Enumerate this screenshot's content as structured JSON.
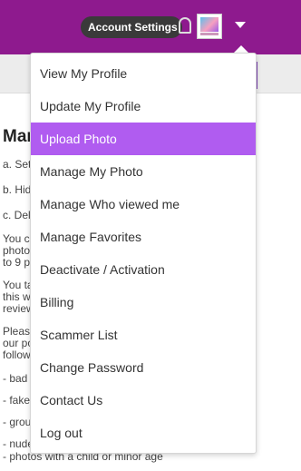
{
  "header": {
    "tooltip": "Account Settings",
    "brand_color": "#8e1a8e"
  },
  "menu": {
    "accent_color": "#b05cf0",
    "items": [
      {
        "label": "View My Profile"
      },
      {
        "label": "Update My Profile"
      },
      {
        "label": "Upload Photo",
        "active": true
      },
      {
        "label": "Manage My Photo"
      },
      {
        "label": "Manage Who viewed me"
      },
      {
        "label": "Manage Favorites"
      },
      {
        "label": "Deactivate / Activation"
      },
      {
        "label": "Billing"
      },
      {
        "label": "Scammer List"
      },
      {
        "label": "Change Password"
      },
      {
        "label": "Contact Us"
      },
      {
        "label": "Log out"
      }
    ]
  },
  "content": {
    "title": "Mar",
    "lines": [
      "a. Set",
      "b. Hid",
      "c. Del",
      "You ca",
      "photo",
      "to 9 p",
      "You ta",
      "this w",
      "review",
      "Pleas",
      "our po",
      "follow",
      "- bad",
      "- fake",
      "- grou",
      "- nude"
    ],
    "last_line": "- photos with a child or minor age"
  }
}
